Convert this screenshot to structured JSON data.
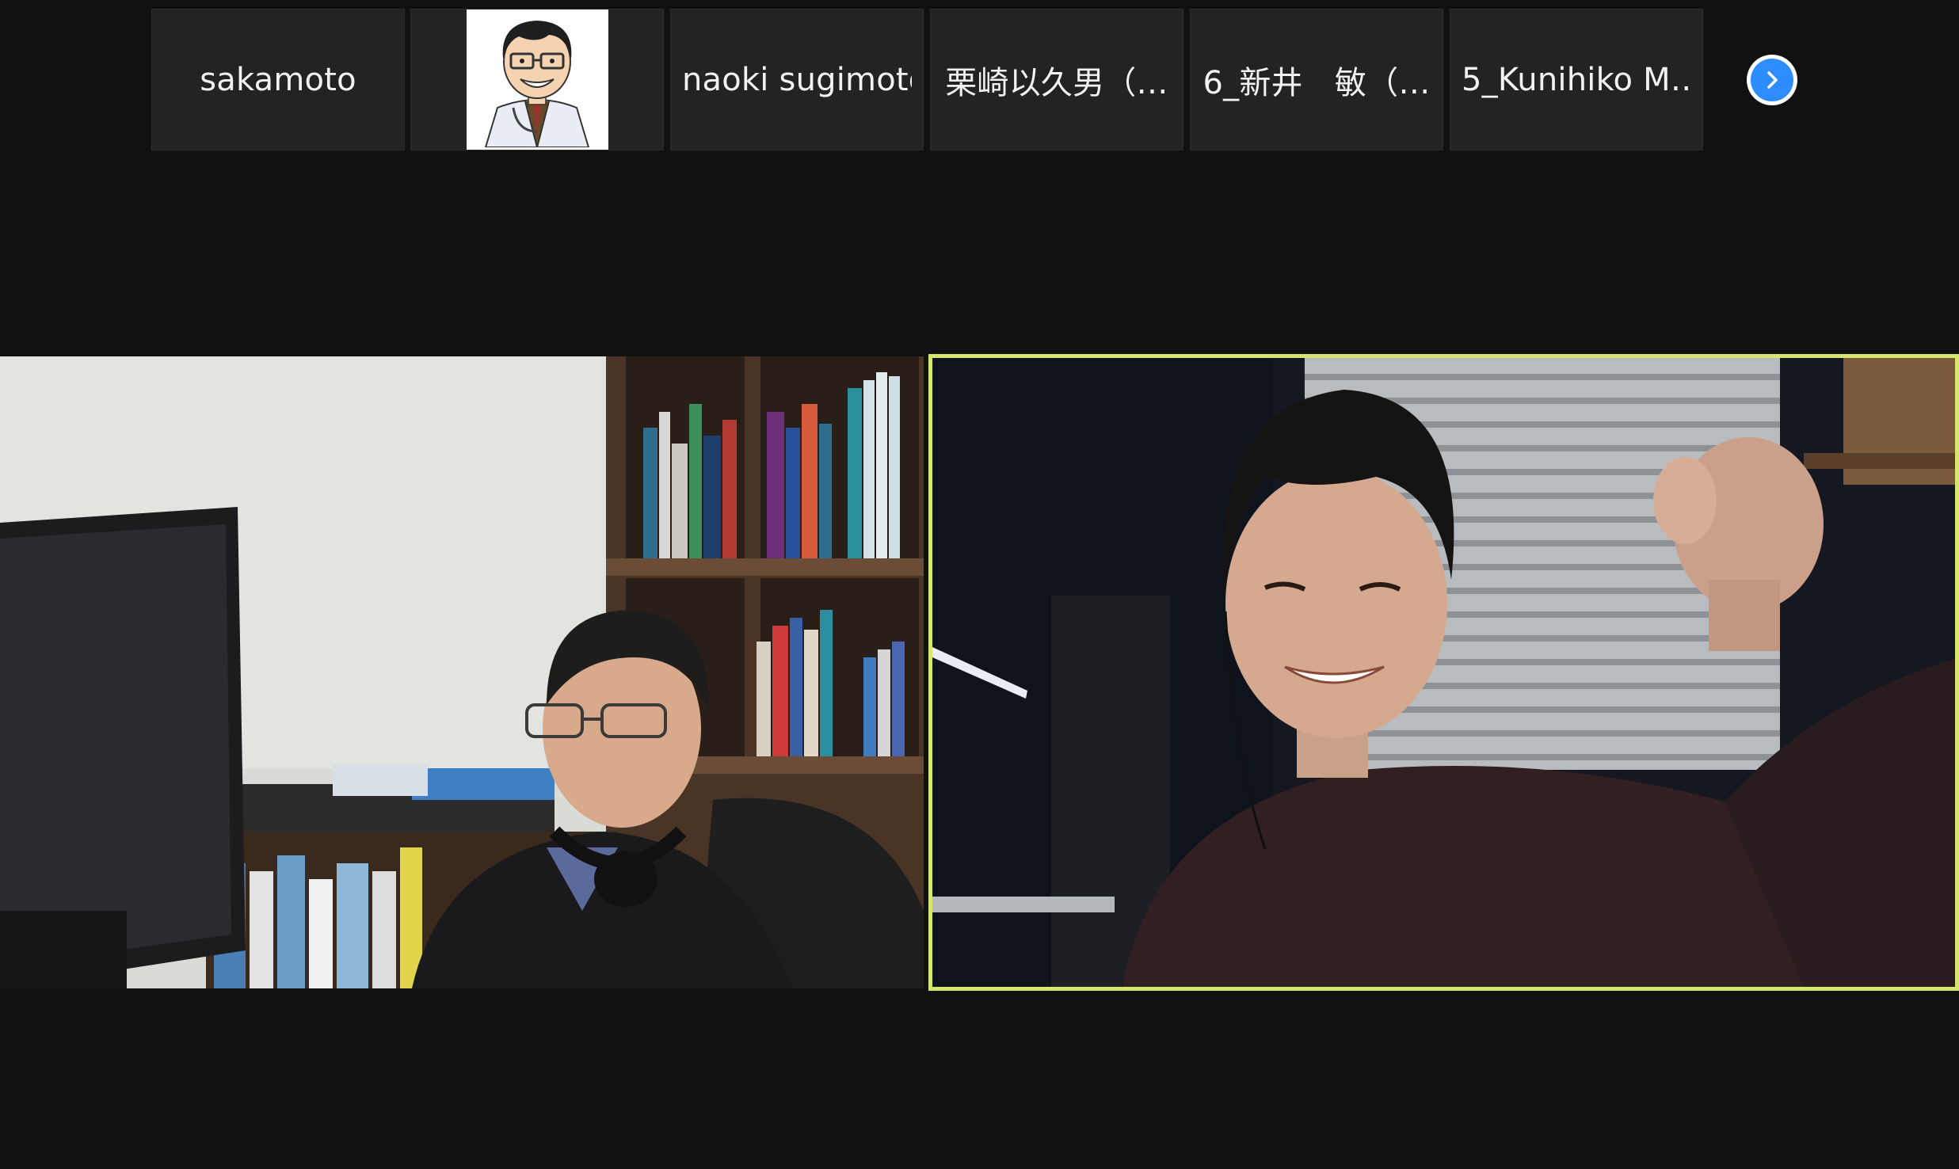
{
  "participant_strip": {
    "tiles": [
      {
        "name": "sakamoto"
      },
      {
        "name": ""
      },
      {
        "name": "naoki sugimoto"
      },
      {
        "name": "栗崎以久男（…"
      },
      {
        "name": "6_新井　敏（…"
      },
      {
        "name": "5_Kunihiko M…"
      }
    ],
    "next_icon": "chevron-right-icon"
  },
  "videos": {
    "left": {
      "subject": "man-with-glasses-headphones-in-office"
    },
    "right": {
      "subject": "smiling-man-gesturing",
      "active_speaker": true
    }
  },
  "colors": {
    "background": "#111111",
    "tile": "#232323",
    "active_speaker_border": "#d6e56b",
    "next_button": "#2d8cff"
  }
}
